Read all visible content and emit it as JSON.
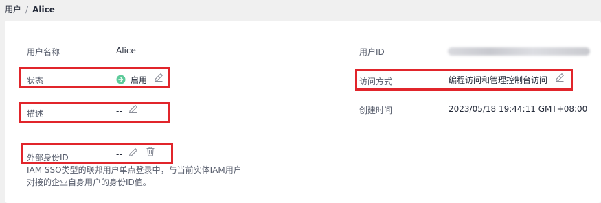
{
  "breadcrumb": {
    "parent": "用户",
    "separator": "/",
    "current": "Alice"
  },
  "fields": {
    "username": {
      "label": "用户名称",
      "value": "Alice"
    },
    "user_id": {
      "label": "用户ID",
      "value": ""
    },
    "status": {
      "label": "状态",
      "value": "启用"
    },
    "access": {
      "label": "访问方式",
      "value": "编程访问和管理控制台访问"
    },
    "description": {
      "label": "描述",
      "value": "--"
    },
    "created": {
      "label": "创建时间",
      "value": "2023/05/18 19:44:11 GMT+08:00"
    },
    "external_id": {
      "label": "外部身份ID",
      "value": "--",
      "hint_line1": "IAM SSO类型的联邦用户单点登录中，与当前实体IAM用户",
      "hint_line2": "对接的企业自身用户的身份ID值。"
    }
  },
  "colors": {
    "highlight": "#e1252b",
    "enabled": "#5dcb9a",
    "icon": "#8a8e99"
  }
}
